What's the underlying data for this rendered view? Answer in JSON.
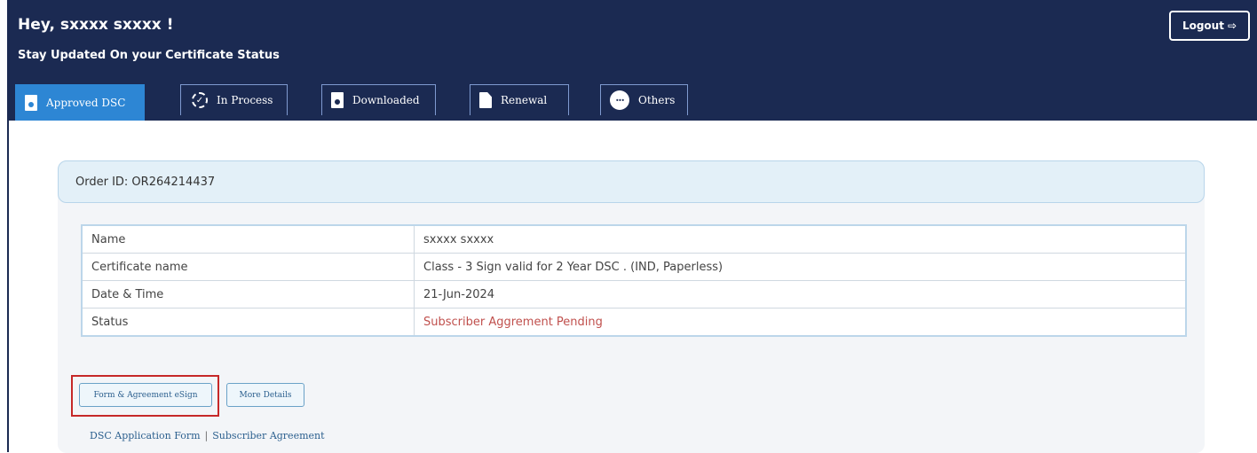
{
  "header": {
    "greeting": "Hey, sxxxx  sxxxx !",
    "subtitle": "Stay Updated On your Certificate Status",
    "logout_label": "Logout",
    "logout_icon": "logout-arrow-icon"
  },
  "tabs": [
    {
      "label": "Approved DSC",
      "icon": "document-icon",
      "active": true
    },
    {
      "label": "In Process",
      "icon": "progress-icon",
      "active": false
    },
    {
      "label": "Downloaded",
      "icon": "document-icon",
      "active": false
    },
    {
      "label": "Renewal",
      "icon": "file-icon",
      "active": false
    },
    {
      "label": "Others",
      "icon": "more-dots-icon",
      "active": false
    }
  ],
  "order": {
    "order_id_label": "Order ID: OR264214437",
    "rows": [
      {
        "label": "Name",
        "value": "sxxxx sxxxx"
      },
      {
        "label": "Certificate name",
        "value": "Class - 3 Sign valid for 2 Year DSC . (IND, Paperless)"
      },
      {
        "label": "Date & Time",
        "value": "21-Jun-2024"
      },
      {
        "label": "Status",
        "value": "Subscriber Aggrement Pending"
      }
    ],
    "buttons": {
      "esign_label": "Form & Agreement eSign",
      "more_details_label": "More Details"
    },
    "links": {
      "application_form": "DSC Application Form",
      "separator": "|",
      "subscriber_agreement": "Subscriber Agreement"
    }
  },
  "colors": {
    "header_bg": "#1b2a52",
    "active_tab": "#2d86d4",
    "status_pending": "#c0504d",
    "highlight_border": "#c62828"
  }
}
